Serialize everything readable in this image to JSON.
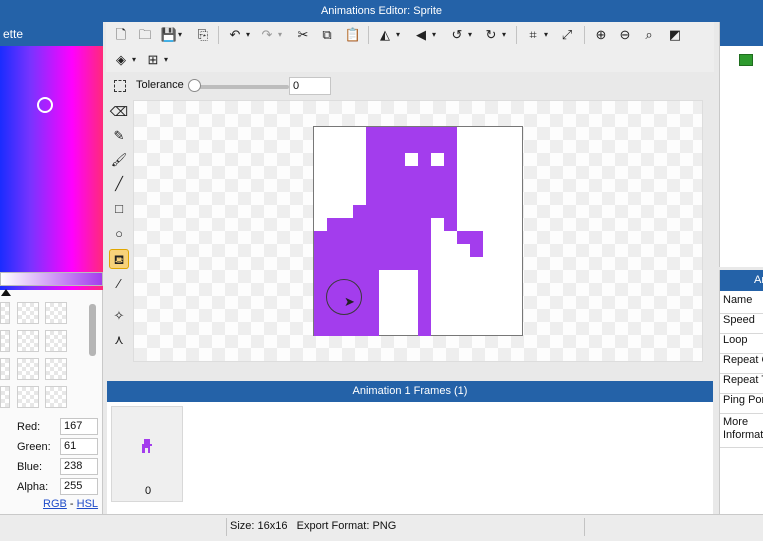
{
  "window": {
    "title": "Animations Editor: Sprite"
  },
  "palette": {
    "header": "ette",
    "rgba": {
      "red_label": "Red:",
      "red": "167",
      "green_label": "Green:",
      "green": "61",
      "blue_label": "Blue:",
      "blue": "238",
      "alpha_label": "Alpha:",
      "alpha": "255"
    },
    "mode_rgb": "RGB",
    "mode_sep": "-",
    "mode_hsl": "HSL"
  },
  "toolbar": {
    "tolerance_label": "Tolerance",
    "tolerance_value": "0",
    "tolerance_fraction": 0.0
  },
  "frames": {
    "header": "Animation 1 Frames (1)",
    "items": [
      {
        "index": "0"
      }
    ]
  },
  "properties": {
    "header": "An",
    "rows": [
      "Name",
      "Speed",
      "Loop",
      "Repeat C",
      "Repeat T",
      "Ping Pon",
      "More Informat"
    ]
  },
  "status": {
    "text": "Size: 16x16   Export Format: PNG"
  },
  "colors": {
    "accent": "#2462a8",
    "sprite": "#a33ded",
    "active_tool": "#f7d27a"
  },
  "icons": {
    "toolbar": [
      "new-file-icon",
      "open-folder-icon",
      "save-icon",
      "export-icon",
      "undo-icon",
      "redo-icon",
      "cut-icon",
      "copy-icon",
      "paste-icon",
      "flip-horizontal-icon",
      "flip-vertical-icon",
      "rotate-left-icon",
      "rotate-right-icon",
      "crop-icon",
      "resize-icon",
      "zoom-in-icon",
      "zoom-out-icon",
      "zoom-fit-icon",
      "invert-icon",
      "layers-icon",
      "grid-icon"
    ],
    "tools": [
      "eraser-icon",
      "pencil-icon",
      "brush-icon",
      "line-icon",
      "rectangle-icon",
      "ellipse-icon",
      "fill-bucket-icon",
      "eyedropper-icon",
      "move-point-icon",
      "nodes-icon"
    ]
  }
}
